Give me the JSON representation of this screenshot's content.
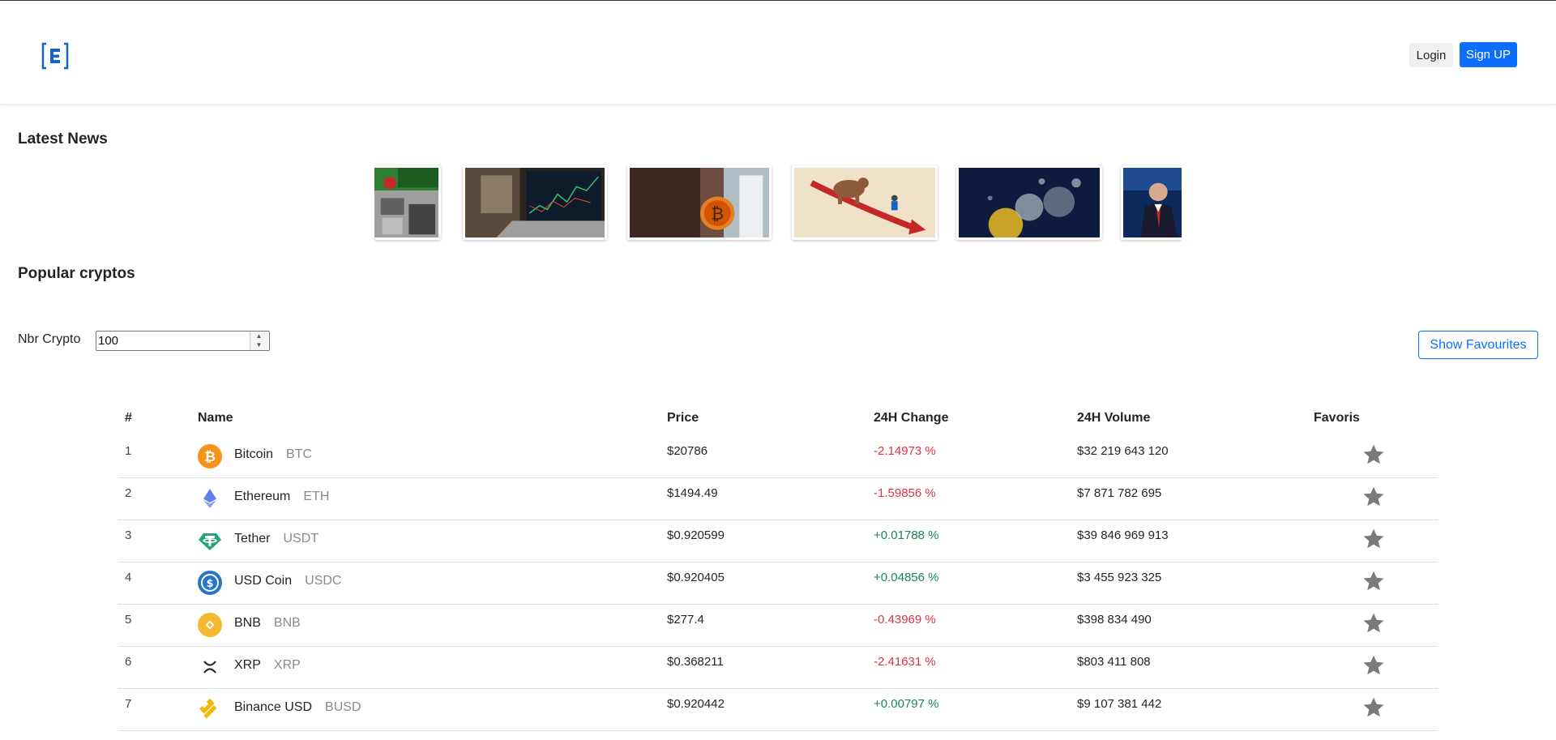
{
  "header": {
    "logo_text": "E",
    "login_label": "Login",
    "signup_label": "Sign UP"
  },
  "news": {
    "title": "Latest News"
  },
  "cryptos": {
    "title": "Popular cryptos",
    "nbr_label": "Nbr Crypto",
    "nbr_value": "100",
    "show_favourites_label": "Show Favourites"
  },
  "table": {
    "headers": {
      "rank": "#",
      "name": "Name",
      "price": "Price",
      "change": "24H Change",
      "volume": "24H Volume",
      "favoris": "Favoris"
    },
    "rows": [
      {
        "rank": "1",
        "name": "Bitcoin",
        "symbol": "BTC",
        "price": "$20786",
        "change": "-2.14973 %",
        "volume": "$32 219 643 120",
        "icon": "bitcoin-icon",
        "color": "#f7931a"
      },
      {
        "rank": "2",
        "name": "Ethereum",
        "symbol": "ETH",
        "price": "$1494.49",
        "change": "-1.59856 %",
        "volume": "$7 871 782 695",
        "icon": "ethereum-icon",
        "color": "#627eea"
      },
      {
        "rank": "3",
        "name": "Tether",
        "symbol": "USDT",
        "price": "$0.920599",
        "change": "+0.01788 %",
        "volume": "$39 846 969 913",
        "icon": "tether-icon",
        "color": "#26a17b"
      },
      {
        "rank": "4",
        "name": "USD Coin",
        "symbol": "USDC",
        "price": "$0.920405",
        "change": "+0.04856 %",
        "volume": "$3 455 923 325",
        "icon": "usdc-icon",
        "color": "#2775ca"
      },
      {
        "rank": "5",
        "name": "BNB",
        "symbol": "BNB",
        "price": "$277.4",
        "change": "-0.43969 %",
        "volume": "$398 834 490",
        "icon": "bnb-icon",
        "color": "#f3ba2f"
      },
      {
        "rank": "6",
        "name": "XRP",
        "symbol": "XRP",
        "price": "$0.368211",
        "change": "-2.41631 %",
        "volume": "$803 411 808",
        "icon": "xrp-icon",
        "color": "#23292f"
      },
      {
        "rank": "7",
        "name": "Binance USD",
        "symbol": "BUSD",
        "price": "$0.920442",
        "change": "+0.00797 %",
        "volume": "$9 107 381 442",
        "icon": "busd-icon",
        "color": "#f0b90b"
      }
    ]
  },
  "colors": {
    "primary": "#0d6efd",
    "negative": "#dc3545",
    "positive": "#198754",
    "star": "#7a7a7a"
  }
}
